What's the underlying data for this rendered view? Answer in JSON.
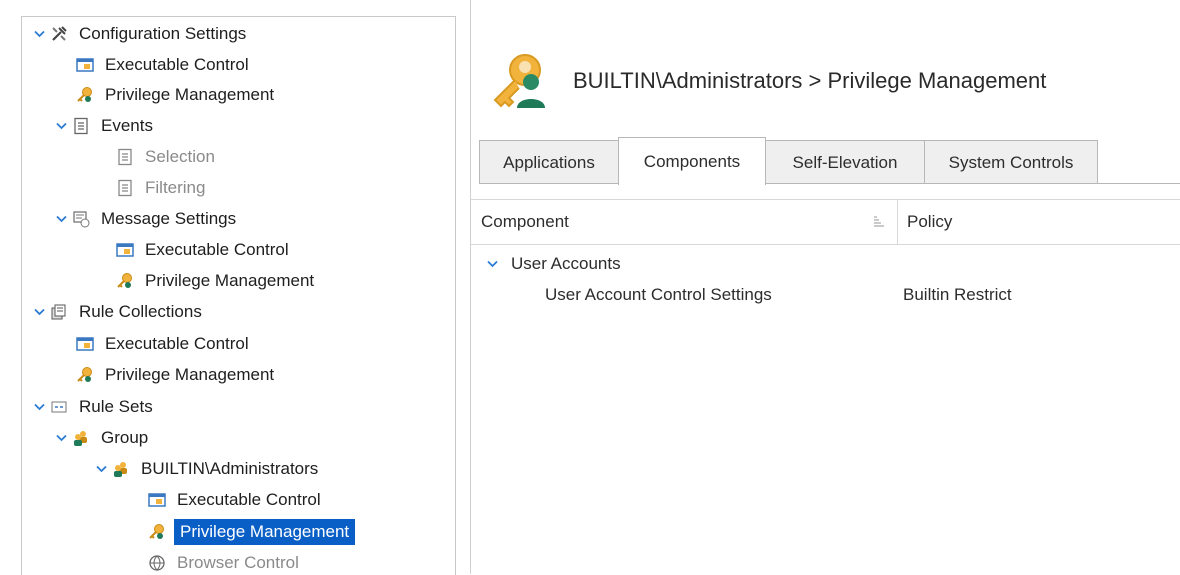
{
  "tree": {
    "configuration_settings": "Configuration Settings",
    "cs_executable_control": "Executable Control",
    "cs_privilege_management": "Privilege Management",
    "events": "Events",
    "selection": "Selection",
    "filtering": "Filtering",
    "message_settings": "Message Settings",
    "ms_executable_control": "Executable Control",
    "ms_privilege_management": "Privilege Management",
    "rule_collections": "Rule Collections",
    "rc_executable_control": "Executable Control",
    "rc_privilege_management": "Privilege Management",
    "rule_sets": "Rule Sets",
    "group": "Group",
    "builtin_administrators": "BUILTIN\\Administrators",
    "ba_executable_control": "Executable Control",
    "ba_privilege_management": "Privilege Management",
    "ba_browser_control": "Browser Control"
  },
  "header": {
    "title": "BUILTIN\\Administrators > Privilege Management"
  },
  "tabs": [
    "Applications",
    "Components",
    "Self-Elevation",
    "System Controls"
  ],
  "active_tab": "Components",
  "grid": {
    "columns": [
      "Component",
      "Policy"
    ],
    "group_label": "User Accounts",
    "rows": [
      {
        "component": "User Account Control Settings",
        "policy": "Builtin Restrict"
      }
    ]
  },
  "colors": {
    "selection": "#0a5fc7",
    "chevron": "#2b7cd3",
    "key_gold": "#f2b33d",
    "person_green": "#1f7a5a"
  }
}
